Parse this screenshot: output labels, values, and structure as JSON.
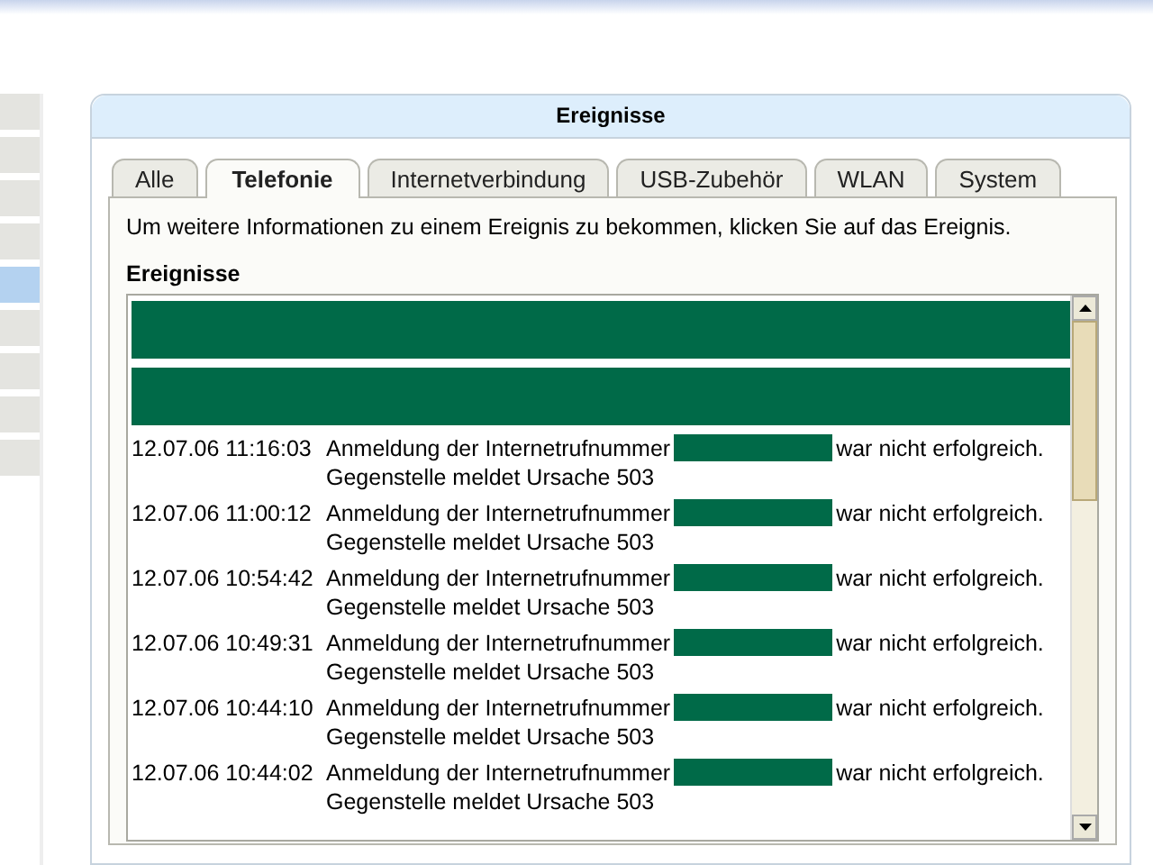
{
  "sidebar": {
    "items": [
      {
        "selected": false
      },
      {
        "selected": false
      },
      {
        "selected": false
      },
      {
        "selected": false
      },
      {
        "selected": true
      },
      {
        "selected": false
      },
      {
        "selected": false
      },
      {
        "selected": false
      },
      {
        "selected": false
      }
    ]
  },
  "panel": {
    "title": "Ereignisse",
    "tabs": [
      {
        "label": "Alle",
        "selected": false
      },
      {
        "label": "Telefonie",
        "selected": true
      },
      {
        "label": "Internetverbindung",
        "selected": false
      },
      {
        "label": "USB-Zubehör",
        "selected": false
      },
      {
        "label": "WLAN",
        "selected": false
      },
      {
        "label": "System",
        "selected": false
      }
    ],
    "hint": "Um weitere Informationen zu einem Ereignis zu bekommen, klicken Sie auf das Ereignis.",
    "list_label": "Ereignisse",
    "events": [
      {
        "kind": "redacted"
      },
      {
        "kind": "redacted"
      },
      {
        "kind": "entry",
        "time": "12.07.06 11:16:03",
        "before": "Anmeldung der Internetrufnummer",
        "after": "war nicht erfolgreich.",
        "detail": "Gegenstelle meldet Ursache 503"
      },
      {
        "kind": "entry",
        "time": "12.07.06 11:00:12",
        "before": "Anmeldung der Internetrufnummer",
        "after": "war nicht erfolgreich.",
        "detail": "Gegenstelle meldet Ursache 503"
      },
      {
        "kind": "entry",
        "time": "12.07.06 10:54:42",
        "before": "Anmeldung der Internetrufnummer",
        "after": "war nicht erfolgreich.",
        "detail": "Gegenstelle meldet Ursache 503"
      },
      {
        "kind": "entry",
        "time": "12.07.06 10:49:31",
        "before": "Anmeldung der Internetrufnummer",
        "after": "war nicht erfolgreich.",
        "detail": "Gegenstelle meldet Ursache 503"
      },
      {
        "kind": "entry",
        "time": "12.07.06 10:44:10",
        "before": "Anmeldung der Internetrufnummer",
        "after": "war nicht erfolgreich.",
        "detail": "Gegenstelle meldet Ursache 503"
      },
      {
        "kind": "entry",
        "time": "12.07.06 10:44:02",
        "before": "Anmeldung der Internetrufnummer",
        "after": "war nicht erfolgreich.",
        "detail": "Gegenstelle meldet Ursache 503"
      }
    ]
  }
}
